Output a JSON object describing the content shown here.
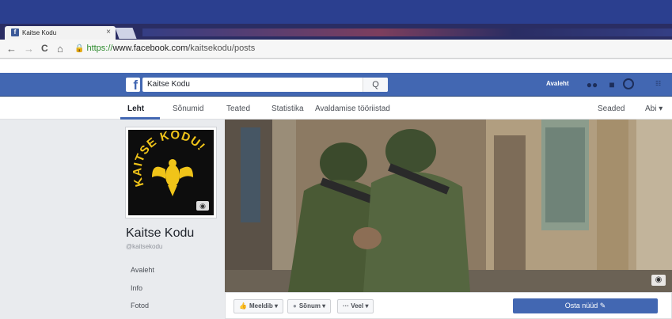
{
  "browser": {
    "tab_title": "Kaitse Kodu",
    "tab_close": "×",
    "favicon_letter": "f",
    "back": "←",
    "forward": "→",
    "reload": "C",
    "home": "⌂",
    "url_scheme": "https://",
    "url_host": "www.facebook.com",
    "url_path": "/kaitsekodu/posts"
  },
  "fb": {
    "logo": "f",
    "search_value": "Kaitse Kodu",
    "search_button": "Q",
    "home_label": "Avaleht"
  },
  "page_tabs": {
    "leht": "Leht",
    "sonumid": "Sõnumid",
    "teated": "Teated",
    "statistika": "Statistika",
    "avaldamise": "Avaldamise tööriistad",
    "seaded": "Seaded",
    "abi": "Abi ▾"
  },
  "profile": {
    "logo_text": "KAITSE KODU!",
    "name": "Kaitse Kodu",
    "handle": "@kaitsekodu"
  },
  "left_nav": {
    "avaleht": "Avaleht",
    "info": "Info",
    "fotod": "Fotod"
  },
  "actions": {
    "meeldib": "Meeldib ▾",
    "sonum": "Sõnum ▾",
    "veel": "··· Veel ▾",
    "buy": "Osta nüüd ✎"
  },
  "colors": {
    "fb_blue": "#4267b2",
    "logo_yellow": "#f0c419"
  }
}
